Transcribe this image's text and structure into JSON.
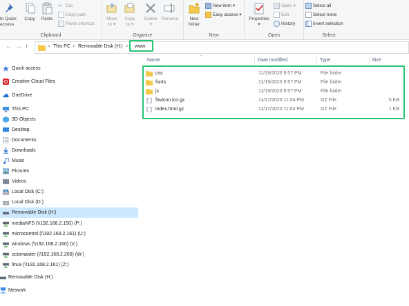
{
  "ribbon": {
    "clipboard": {
      "pin_label_1": "to Quick",
      "pin_label_2": "access",
      "copy_label": "Copy",
      "paste_label": "Paste",
      "cut_label": "Cut",
      "copy_path_label": "Copy path",
      "paste_shortcut_label": "Paste shortcut",
      "group_label": "Clipboard"
    },
    "organize": {
      "move_to_1": "Move",
      "move_to_2": "to ▾",
      "copy_to_1": "Copy",
      "copy_to_2": "to ▾",
      "delete_label": "Delete",
      "delete_caret": "▾",
      "rename_label": "Rename",
      "group_label": "Organize"
    },
    "new": {
      "new_folder_1": "New",
      "new_folder_2": "folder",
      "new_item_label": "New item ▾",
      "easy_access_label": "Easy access ▾",
      "group_label": "New"
    },
    "open": {
      "properties_label": "Properties",
      "properties_caret": "▾",
      "open_label": "Open ▾",
      "edit_label": "Edit",
      "history_label": "History",
      "group_label": "Open"
    },
    "select": {
      "select_all_label": "Select all",
      "select_none_label": "Select none",
      "invert_label": "Invert selection",
      "group_label": "Select"
    }
  },
  "address": {
    "crumb_this_pc": "This PC",
    "sep1": ">",
    "crumb_disk": "Removable Disk (H:)",
    "sep2": ">",
    "crumb_folder": "www",
    "sep0": ">"
  },
  "nav": [
    {
      "label": "Quick access",
      "icon": "star-icon"
    },
    {
      "label": "Creative Cloud Files",
      "icon": "creative-cloud-icon"
    },
    {
      "label": "OneDrive",
      "icon": "cloud-icon"
    },
    {
      "label": "This PC",
      "icon": "computer-icon"
    },
    {
      "label": "3D Objects",
      "icon": "cube-icon"
    },
    {
      "label": "Desktop",
      "icon": "desktop-icon"
    },
    {
      "label": "Documents",
      "icon": "documents-icon"
    },
    {
      "label": "Downloads",
      "icon": "download-icon"
    },
    {
      "label": "Music",
      "icon": "music-icon"
    },
    {
      "label": "Pictures",
      "icon": "pictures-icon"
    },
    {
      "label": "Videos",
      "icon": "video-icon"
    },
    {
      "label": "Local Disk (C:)",
      "icon": "disk-icon"
    },
    {
      "label": "Local Disk (D:)",
      "icon": "disk-icon"
    },
    {
      "label": "Removable Disk (H:)",
      "icon": "usb-drive-icon"
    },
    {
      "label": "mediaNFS (\\\\192.168.2.150) (P:)",
      "icon": "network-drive-icon"
    },
    {
      "label": "microcontrol (\\\\192.168.2.161) (U:)",
      "icon": "network-drive-icon"
    },
    {
      "label": "windows (\\\\192.168.2.160) (V:)",
      "icon": "network-drive-icon"
    },
    {
      "label": "octomaster (\\\\192.168.2.200) (W:)",
      "icon": "network-drive-icon"
    },
    {
      "label": "linux (\\\\192.168.2.161) (Z:)",
      "icon": "network-drive-icon"
    },
    {
      "label": "Removable Disk (H:)",
      "icon": "usb-drive-icon"
    },
    {
      "label": "Network",
      "icon": "network-icon"
    }
  ],
  "columns": {
    "name": "Name",
    "date": "Date modified",
    "type": "Type",
    "size": "Size"
  },
  "files": [
    {
      "name": "css",
      "date": "11/19/2020 9:57 PM",
      "type": "File folder",
      "size": "",
      "kind": "folder"
    },
    {
      "name": "fonts",
      "date": "11/19/2020 9:57 PM",
      "type": "File folder",
      "size": "",
      "kind": "folder"
    },
    {
      "name": "js",
      "date": "11/19/2020 9:57 PM",
      "type": "File folder",
      "size": "",
      "kind": "folder"
    },
    {
      "name": "favicon.ico.gz",
      "date": "11/17/2020 11:04 PM",
      "type": "GZ File",
      "size": "5 KB",
      "kind": "file"
    },
    {
      "name": "index.html.gz",
      "date": "11/17/2020 11:04 PM",
      "type": "GZ File",
      "size": "1 KB",
      "kind": "file"
    }
  ],
  "colors": {
    "highlight": "#22c470",
    "folder": "#f2c94c",
    "selected_nav": "#cce8ff"
  }
}
